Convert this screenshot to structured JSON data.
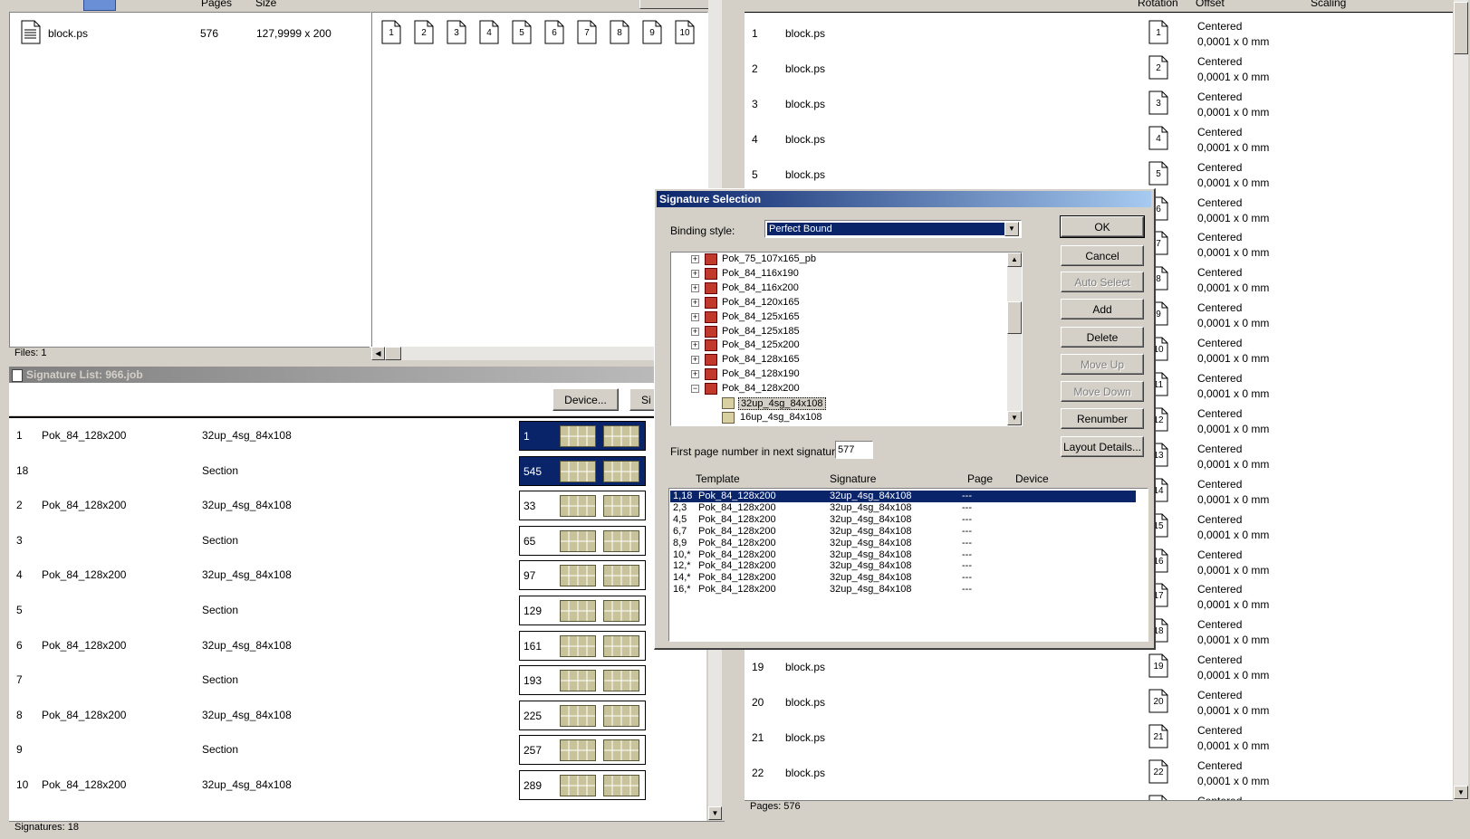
{
  "files_panel": {
    "col_pages": "Pages",
    "col_size": "Size",
    "file_name": "block.ps",
    "file_pages": "576",
    "file_size": "127,9999 x 200",
    "status": "Files: 1",
    "page_thumbs": [
      "1",
      "2",
      "3",
      "4",
      "5",
      "6",
      "7",
      "8",
      "9",
      "10"
    ]
  },
  "signature_list": {
    "title": "Signature List: 966.job",
    "device_button": "Device...",
    "si_button": "Si",
    "status": "Signatures: 18",
    "rows": [
      {
        "n": "1",
        "template": "Pok_84_128x200",
        "sig": "32up_4sg_84x108",
        "start": "1",
        "selected": true
      },
      {
        "n": "18",
        "template": "",
        "sig": "Section",
        "start": "545",
        "selected": true
      },
      {
        "n": "2",
        "template": "Pok_84_128x200",
        "sig": "32up_4sg_84x108",
        "start": "33",
        "selected": false
      },
      {
        "n": "3",
        "template": "",
        "sig": "Section",
        "start": "65",
        "selected": false
      },
      {
        "n": "4",
        "template": "Pok_84_128x200",
        "sig": "32up_4sg_84x108",
        "start": "97",
        "selected": false
      },
      {
        "n": "5",
        "template": "",
        "sig": "Section",
        "start": "129",
        "selected": false
      },
      {
        "n": "6",
        "template": "Pok_84_128x200",
        "sig": "32up_4sg_84x108",
        "start": "161",
        "selected": false
      },
      {
        "n": "7",
        "template": "",
        "sig": "Section",
        "start": "193",
        "selected": false
      },
      {
        "n": "8",
        "template": "Pok_84_128x200",
        "sig": "32up_4sg_84x108",
        "start": "225",
        "selected": false
      },
      {
        "n": "9",
        "template": "",
        "sig": "Section",
        "start": "257",
        "selected": false
      },
      {
        "n": "10",
        "template": "Pok_84_128x200",
        "sig": "32up_4sg_84x108",
        "start": "289",
        "selected": false
      }
    ]
  },
  "pages_panel": {
    "col_rotation": "Rotation",
    "col_offset": "Offset",
    "col_scaling": "Scaling",
    "status": "Pages: 576",
    "offset_mode": "Centered",
    "offset_value": "0,0001 x 0 mm",
    "last_partial": "Centered",
    "rows": [
      {
        "n": "1",
        "file": "block.ps"
      },
      {
        "n": "2",
        "file": "block.ps"
      },
      {
        "n": "3",
        "file": "block.ps"
      },
      {
        "n": "4",
        "file": "block.ps"
      },
      {
        "n": "5",
        "file": "block.ps"
      },
      {
        "n": "6",
        "file": ""
      },
      {
        "n": "7",
        "file": ""
      },
      {
        "n": "8",
        "file": ""
      },
      {
        "n": "9",
        "file": ""
      },
      {
        "n": "10",
        "file": ""
      },
      {
        "n": "11",
        "file": ""
      },
      {
        "n": "12",
        "file": ""
      },
      {
        "n": "13",
        "file": ""
      },
      {
        "n": "14",
        "file": ""
      },
      {
        "n": "15",
        "file": ""
      },
      {
        "n": "16",
        "file": ""
      },
      {
        "n": "17",
        "file": ""
      },
      {
        "n": "18",
        "file": ""
      },
      {
        "n": "19",
        "file": "block.ps"
      },
      {
        "n": "20",
        "file": "block.ps"
      },
      {
        "n": "21",
        "file": "block.ps"
      },
      {
        "n": "22",
        "file": "block.ps"
      }
    ]
  },
  "dialog": {
    "title": "Signature Selection",
    "binding_label": "Binding style:",
    "binding_value": "Perfect Bound",
    "tree": [
      {
        "label": "Pok_75_107x165_pb",
        "kind": "template",
        "expanded": false
      },
      {
        "label": "Pok_84_116x190",
        "kind": "template",
        "expanded": false
      },
      {
        "label": "Pok_84_116x200",
        "kind": "template",
        "expanded": false
      },
      {
        "label": "Pok_84_120x165",
        "kind": "template",
        "expanded": false
      },
      {
        "label": "Pok_84_125x165",
        "kind": "template",
        "expanded": false
      },
      {
        "label": "Pok_84_125x185",
        "kind": "template",
        "expanded": false
      },
      {
        "label": "Pok_84_125x200",
        "kind": "template",
        "expanded": false
      },
      {
        "label": "Pok_84_128x165",
        "kind": "template",
        "expanded": false
      },
      {
        "label": "Pok_84_128x190",
        "kind": "template",
        "expanded": false
      },
      {
        "label": "Pok_84_128x200",
        "kind": "template",
        "expanded": true
      },
      {
        "label": "32up_4sg_84x108",
        "kind": "signature",
        "selected": true
      },
      {
        "label": "16up_4sg_84x108",
        "kind": "signature",
        "selected": false
      }
    ],
    "first_page_label": "First page number in next signature:",
    "first_page_value": "577",
    "list_headers": {
      "template": "Template",
      "signature": "Signature",
      "page": "Page",
      "device": "Device"
    },
    "list_rows": [
      {
        "id": "1,18",
        "template": "Pok_84_128x200",
        "signature": "32up_4sg_84x108",
        "page": "---",
        "selected": true
      },
      {
        "id": "2,3",
        "template": "Pok_84_128x200",
        "signature": "32up_4sg_84x108",
        "page": "---",
        "selected": false
      },
      {
        "id": "4,5",
        "template": "Pok_84_128x200",
        "signature": "32up_4sg_84x108",
        "page": "---",
        "selected": false
      },
      {
        "id": "6,7",
        "template": "Pok_84_128x200",
        "signature": "32up_4sg_84x108",
        "page": "---",
        "selected": false
      },
      {
        "id": "8,9",
        "template": "Pok_84_128x200",
        "signature": "32up_4sg_84x108",
        "page": "---",
        "selected": false
      },
      {
        "id": "10,*",
        "template": "Pok_84_128x200",
        "signature": "32up_4sg_84x108",
        "page": "---",
        "selected": false
      },
      {
        "id": "12,*",
        "template": "Pok_84_128x200",
        "signature": "32up_4sg_84x108",
        "page": "---",
        "selected": false
      },
      {
        "id": "14,*",
        "template": "Pok_84_128x200",
        "signature": "32up_4sg_84x108",
        "page": "---",
        "selected": false
      },
      {
        "id": "16,*",
        "template": "Pok_84_128x200",
        "signature": "32up_4sg_84x108",
        "page": "---",
        "selected": false
      }
    ],
    "buttons": {
      "ok": "OK",
      "cancel": "Cancel",
      "auto_select": "Auto Select",
      "add": "Add",
      "delete": "Delete",
      "move_up": "Move Up",
      "move_down": "Move Down",
      "renumber": "Renumber",
      "layout_details": "Layout Details..."
    }
  },
  "colors": {
    "selection": "#0a246a",
    "dialog_title_start": "#0a246a",
    "dialog_title_end": "#a6caf0",
    "face": "#d4d0c8"
  }
}
